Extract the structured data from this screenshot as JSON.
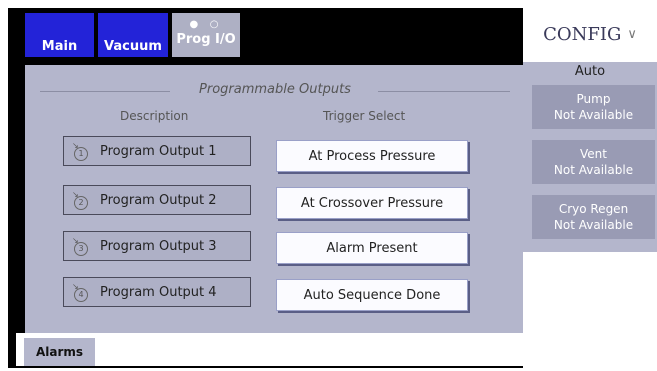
{
  "tabs": [
    {
      "label": "Main"
    },
    {
      "label": "Vacuum"
    },
    {
      "label": "Prog I/O",
      "indicator": "● ○",
      "selected": true
    }
  ],
  "panel": {
    "title": "Programmable Outputs",
    "description_header": "Description",
    "trigger_header": "Trigger Select",
    "outputs": [
      {
        "index": "1",
        "label": "Program Output 1",
        "trigger": "At Process Pressure"
      },
      {
        "index": "2",
        "label": "Program Output 2",
        "trigger": "At Crossover Pressure"
      },
      {
        "index": "3",
        "label": "Program Output 3",
        "trigger": "Alarm Present"
      },
      {
        "index": "4",
        "label": "Program Output 4",
        "trigger": "Auto Sequence Done"
      }
    ]
  },
  "bottom": {
    "alarms_label": "Alarms"
  },
  "right": {
    "config_label": "CONFIG",
    "config_chevron": "∨",
    "auto_label": "Auto",
    "buttons": [
      {
        "name": "Pump",
        "status": "Not Available"
      },
      {
        "name": "Vent",
        "status": "Not Available"
      },
      {
        "name": "Cryo Regen",
        "status": "Not Available"
      }
    ]
  },
  "colors": {
    "tab_active": "#2323d8",
    "tab_selected": "#aeb0c4",
    "panel_bg": "#b4b6cc",
    "right_button_bg": "#999bb4"
  }
}
